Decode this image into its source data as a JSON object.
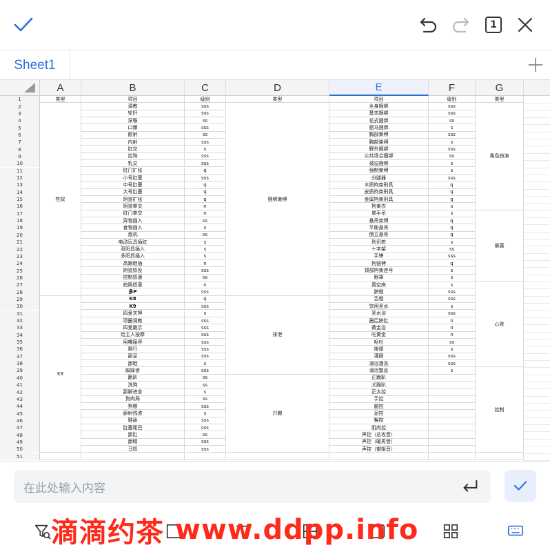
{
  "toolbar": {
    "page_indicator": "1"
  },
  "tab": {
    "sheet_name": "Sheet1"
  },
  "columns": [
    "A",
    "B",
    "C",
    "D",
    "E",
    "F",
    "G"
  ],
  "selected_column": "E",
  "rows": [
    {
      "n": "1",
      "b": "项目",
      "c": "级别",
      "e": "项目",
      "f": "级别"
    },
    {
      "n": "2",
      "b": "调教",
      "c": "sss",
      "e": "全身捆绑",
      "f": "sss"
    },
    {
      "n": "3",
      "b": "轮奸",
      "c": "sss",
      "e": "基本捆绑",
      "f": "sss"
    },
    {
      "n": "4",
      "b": "深喉",
      "c": "ss",
      "e": "花式捆绑",
      "f": "ss"
    },
    {
      "n": "5",
      "b": "口爆",
      "c": "sss",
      "e": "驷马捆绑",
      "f": "s"
    },
    {
      "n": "6",
      "b": "颜射",
      "c": "ss",
      "e": "胸部束缚",
      "f": "sss"
    },
    {
      "n": "7",
      "b": "内射",
      "c": "sss",
      "e": "胸部束缚",
      "f": "s"
    },
    {
      "n": "8",
      "b": "肛交",
      "c": "s",
      "e": "野外捆绑",
      "f": "sss"
    },
    {
      "n": "9",
      "b": "拉珠",
      "c": "sss",
      "e": "公共场合捆绑",
      "f": "ss"
    },
    {
      "n": "10",
      "b": "乳交",
      "c": "sss",
      "e": "被迫捆绑",
      "f": "s"
    },
    {
      "n": "11",
      "b": "肛门扩张",
      "c": "q",
      "e": "强制束缚",
      "f": "s"
    },
    {
      "n": "12",
      "b": "小号肛塞",
      "c": "sss",
      "e": "分腿器",
      "f": "sss"
    },
    {
      "n": "13",
      "b": "中号肛塞",
      "c": "q",
      "e": "木质拘束刑具",
      "f": "q"
    },
    {
      "n": "14",
      "b": "大号肛塞",
      "c": "q",
      "e": "皮质拘束刑具",
      "f": "q"
    },
    {
      "n": "15",
      "b": "阴道扩张",
      "c": "q",
      "e": "金属拘束刑具",
      "f": "q"
    },
    {
      "n": "16",
      "b": "阴道拳交",
      "c": "n",
      "e": "拘束衣",
      "f": "s"
    },
    {
      "n": "17",
      "b": "肛门拳交",
      "c": "n",
      "e": "单手吊",
      "f": "s"
    },
    {
      "n": "18",
      "b": "异物插入",
      "c": "ss",
      "e": "悬吊束缚",
      "f": "q"
    },
    {
      "n": "19",
      "b": "食物插入",
      "c": "s",
      "e": "平衡悬吊",
      "f": "q"
    },
    {
      "n": "20",
      "b": "炮机",
      "c": "ss",
      "e": "倒立悬吊",
      "f": "q"
    },
    {
      "n": "21",
      "b": "电动玩具插肛",
      "c": "s",
      "e": "刑讯桩",
      "f": "s"
    },
    {
      "n": "22",
      "b": "双阳具插入",
      "c": "s",
      "e": "十字架",
      "f": "ss"
    },
    {
      "n": "23",
      "b": "多阳具插入",
      "c": "s",
      "e": "手铐",
      "f": "sss"
    },
    {
      "n": "24",
      "b": "高跟鞋插",
      "c": "n",
      "e": "拘链铐",
      "f": "q"
    },
    {
      "n": "25",
      "b": "阴道奴役",
      "c": "sss",
      "e": "颈部拘束连号",
      "f": "s"
    },
    {
      "n": "26",
      "b": "控制奴隶",
      "c": "ss",
      "e": "眼罩",
      "f": "s"
    },
    {
      "n": "27",
      "b": "拍照奴隶",
      "c": "n",
      "e": "真空床",
      "f": "s"
    },
    {
      "n": "28",
      "b": "多P",
      "c": "sss",
      "e": "脐橙",
      "f": "sss"
    },
    {
      "n": "29",
      "b": "K8",
      "c": "q",
      "e": "舌橙",
      "f": "sss"
    },
    {
      "n": "30",
      "b": "K9",
      "c": "sss",
      "e": "饮用圣水",
      "f": "s"
    },
    {
      "n": "31",
      "b": "四爱关押",
      "c": "s",
      "e": "圣水浴",
      "f": "sss"
    },
    {
      "n": "32",
      "b": "项圈调教",
      "c": "sss",
      "e": "圈后脐肛",
      "f": "n"
    },
    {
      "n": "33",
      "b": "四爱跪示",
      "c": "sss",
      "e": "黄金浴",
      "f": "n"
    },
    {
      "n": "34",
      "b": "给主人按摩",
      "c": "sss",
      "e": "吃黄金",
      "f": "n"
    },
    {
      "n": "35",
      "b": "用嘴接停",
      "c": "sss",
      "e": "呕吐",
      "f": "ss"
    },
    {
      "n": "36",
      "b": "爬行",
      "c": "sss",
      "e": "排便",
      "f": "s"
    },
    {
      "n": "37",
      "b": "舔足",
      "c": "sss",
      "e": "灌肠",
      "f": "sss"
    },
    {
      "n": "38",
      "b": "舔鞋",
      "c": "s",
      "e": "溺浴灌洗",
      "f": "sss"
    },
    {
      "n": "39",
      "b": "脚踩食",
      "c": "sss",
      "e": "溺浴窒息",
      "f": "s"
    },
    {
      "n": "40",
      "b": "跪趴",
      "c": "ss",
      "e": "正跪趴",
      "f": ""
    },
    {
      "n": "41",
      "b": "洗狗",
      "c": "ss",
      "e": "犬跪趴",
      "f": ""
    },
    {
      "n": "42",
      "b": "舔脚进食",
      "c": "s",
      "e": "正太控",
      "f": ""
    },
    {
      "n": "43",
      "b": "狗肉局",
      "c": "ss",
      "e": "手控",
      "f": ""
    },
    {
      "n": "44",
      "b": "狗粮",
      "c": "sss",
      "e": "腿控",
      "f": ""
    },
    {
      "n": "45",
      "b": "舔射残渣",
      "c": "s",
      "e": "足控",
      "f": ""
    },
    {
      "n": "46",
      "b": "鞋舔",
      "c": "sss",
      "e": "臀控",
      "f": ""
    },
    {
      "n": "47",
      "b": "肛塞尾巴",
      "c": "sss",
      "e": "肌肉控",
      "f": ""
    },
    {
      "n": "48",
      "b": "舔肛",
      "c": "ss",
      "e": "声控（总攻音）",
      "f": ""
    },
    {
      "n": "49",
      "b": "舔精",
      "c": "sss",
      "e": "声控（暖男音）",
      "f": ""
    },
    {
      "n": "50",
      "b": "马奴",
      "c": "sss",
      "e": "声控（御姐音）",
      "f": ""
    },
    {
      "n": "51",
      "b": "",
      "c": "",
      "e": "",
      "f": ""
    }
  ],
  "merged": {
    "a_header": "类型",
    "a_group1": "性奴",
    "a_group2": "K9",
    "d_header": "类型",
    "d_group1": "捆绑束缚",
    "d_group2": "排泄",
    "d_group3": "兴趣",
    "g_header": "类型",
    "g_group1": "角色扮演",
    "g_group2": "暴露",
    "g_group3": "心败",
    "g_group4": "控制"
  },
  "input": {
    "placeholder": "在此处输入内容"
  },
  "watermark": {
    "cn": "滴滴约茶",
    "url": "www.ddpp.info"
  },
  "colors": {
    "accent": "#2b6fd6",
    "watermark": "#ff2a1a"
  }
}
